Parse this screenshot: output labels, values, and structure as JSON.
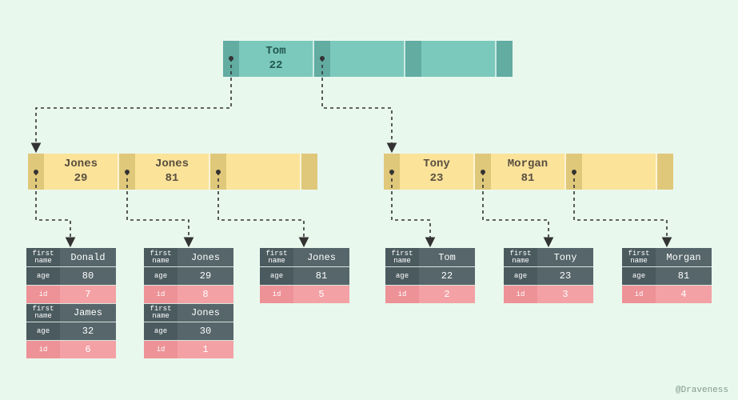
{
  "labels": {
    "first_name": "first name",
    "age": "age",
    "id": "id"
  },
  "root": {
    "keys": [
      {
        "name": "Tom",
        "value": "22"
      }
    ],
    "empty_slots": 2
  },
  "level1": [
    {
      "keys": [
        {
          "name": "Jones",
          "value": "29"
        },
        {
          "name": "Jones",
          "value": "81"
        }
      ],
      "empty_slots": 1
    },
    {
      "keys": [
        {
          "name": "Tony",
          "value": "23"
        },
        {
          "name": "Morgan",
          "value": "81"
        }
      ],
      "empty_slots": 1
    }
  ],
  "leaves": [
    {
      "records": [
        {
          "first_name": "Donald",
          "age": "80",
          "id": "7"
        },
        {
          "first_name": "James",
          "age": "32",
          "id": "6"
        }
      ]
    },
    {
      "records": [
        {
          "first_name": "Jones",
          "age": "29",
          "id": "8"
        },
        {
          "first_name": "Jones",
          "age": "30",
          "id": "1"
        }
      ]
    },
    {
      "records": [
        {
          "first_name": "Jones",
          "age": "81",
          "id": "5"
        }
      ]
    },
    {
      "records": [
        {
          "first_name": "Tom",
          "age": "22",
          "id": "2"
        }
      ]
    },
    {
      "records": [
        {
          "first_name": "Tony",
          "age": "23",
          "id": "3"
        }
      ]
    },
    {
      "records": [
        {
          "first_name": "Morgan",
          "age": "81",
          "id": "4"
        }
      ]
    }
  ],
  "credit": "@Draveness"
}
